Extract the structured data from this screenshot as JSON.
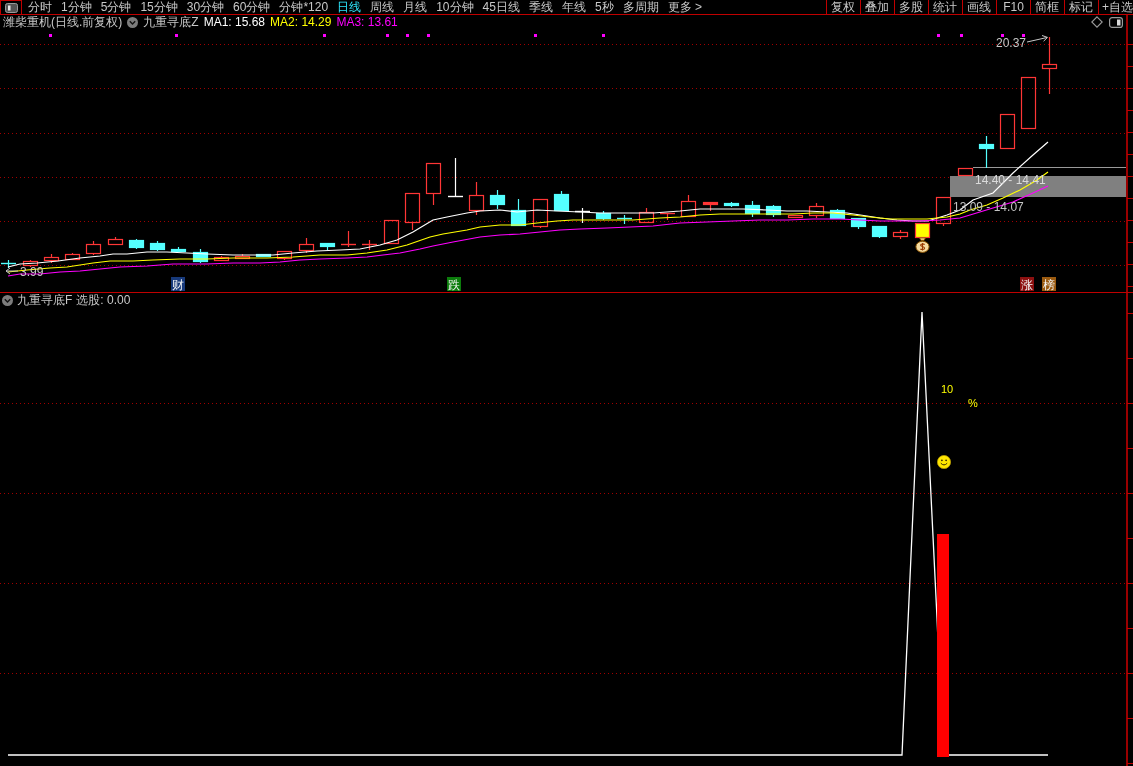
{
  "toolbar": {
    "period_tabs": [
      {
        "label": "分时",
        "selected": false
      },
      {
        "label": "1分钟",
        "selected": false
      },
      {
        "label": "5分钟",
        "selected": false
      },
      {
        "label": "15分钟",
        "selected": false
      },
      {
        "label": "30分钟",
        "selected": false
      },
      {
        "label": "60分钟",
        "selected": false
      },
      {
        "label": "分钟*120",
        "selected": false
      },
      {
        "label": "日线",
        "selected": true
      },
      {
        "label": "周线",
        "selected": false
      },
      {
        "label": "月线",
        "selected": false
      },
      {
        "label": "10分钟",
        "selected": false
      },
      {
        "label": "45日线",
        "selected": false
      },
      {
        "label": "季线",
        "selected": false
      },
      {
        "label": "年线",
        "selected": false
      },
      {
        "label": "5秒",
        "selected": false
      },
      {
        "label": "多周期",
        "selected": false
      }
    ],
    "more_menu": "更多 >",
    "tools": [
      "复权",
      "叠加",
      "多股",
      "统计",
      "画线",
      "F10",
      "简框",
      "标记",
      "+自选"
    ]
  },
  "main_chart": {
    "title": "潍柴重机(日线.前复权)",
    "indicator": "九重寻底Z",
    "ma_readings": [
      {
        "label": "MA1: 15.68",
        "color": "#ffffff"
      },
      {
        "label": "MA2: 14.29",
        "color": "#ffff00"
      },
      {
        "label": "MA3: 13.61",
        "color": "#ff00ff"
      }
    ],
    "high_label": "20.37",
    "low_label": "3.99",
    "zone_labels": [
      "14.40 - 14.41",
      "13.09 - 14.07"
    ],
    "event_markers": [
      {
        "label": "财",
        "color": "#17397a"
      },
      {
        "label": "跌",
        "color": "#0c7c0c"
      },
      {
        "label": "涨",
        "color": "#8c1010"
      },
      {
        "label": "榜",
        "color": "#9a5a10"
      }
    ]
  },
  "sub_chart": {
    "indicator": "九重寻底F",
    "reading": "选股: 0.00",
    "value_label": "10",
    "unit_label": "%"
  }
}
